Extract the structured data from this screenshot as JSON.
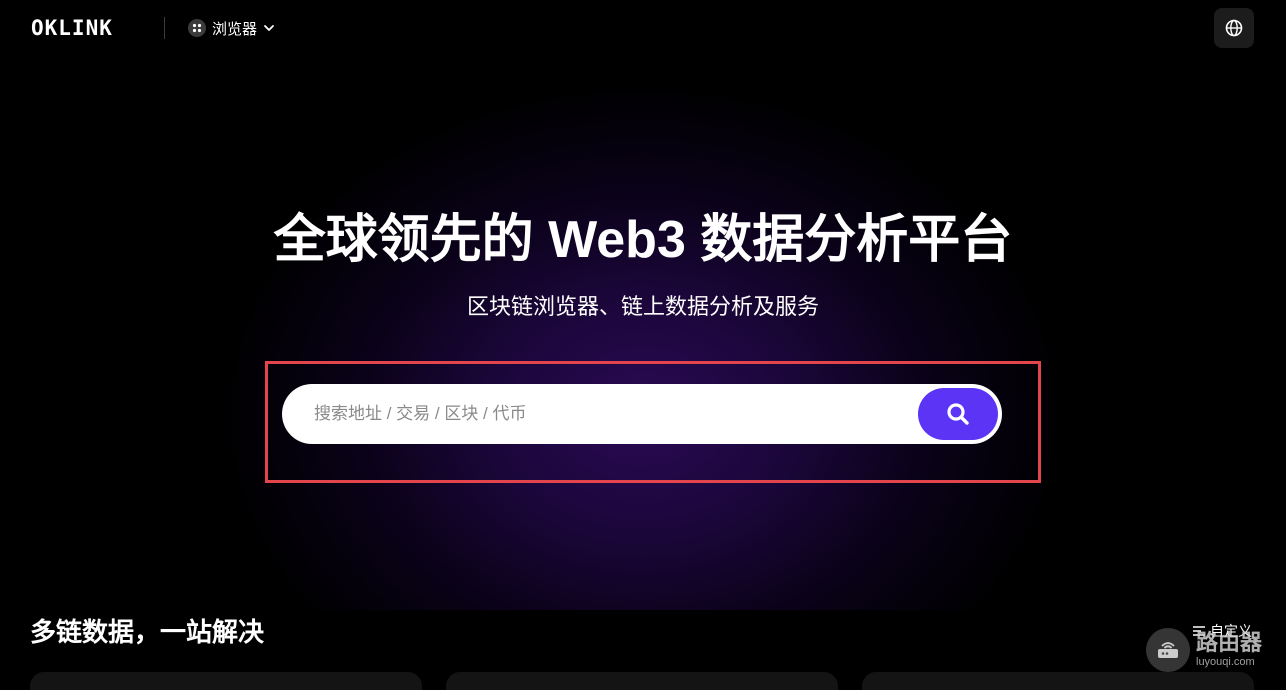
{
  "header": {
    "logo": "OKLINK",
    "explorer_label": "浏览器"
  },
  "hero": {
    "title": "全球领先的 Web3 数据分析平台",
    "subtitle": "区块链浏览器、链上数据分析及服务"
  },
  "search": {
    "placeholder": "搜索地址 / 交易 / 区块 / 代币",
    "value": ""
  },
  "section": {
    "title": "多链数据，一站解决",
    "customize_label": "自定义"
  },
  "watermark": {
    "main": "路由器",
    "sub": "luyouqi.com"
  },
  "colors": {
    "background": "#000000",
    "accent": "#5b34f5",
    "highlight_frame": "#e2454b"
  },
  "icons": [
    "grid-icon",
    "chevron-down-icon",
    "globe-icon",
    "search-icon",
    "customize-icon",
    "router-icon"
  ]
}
